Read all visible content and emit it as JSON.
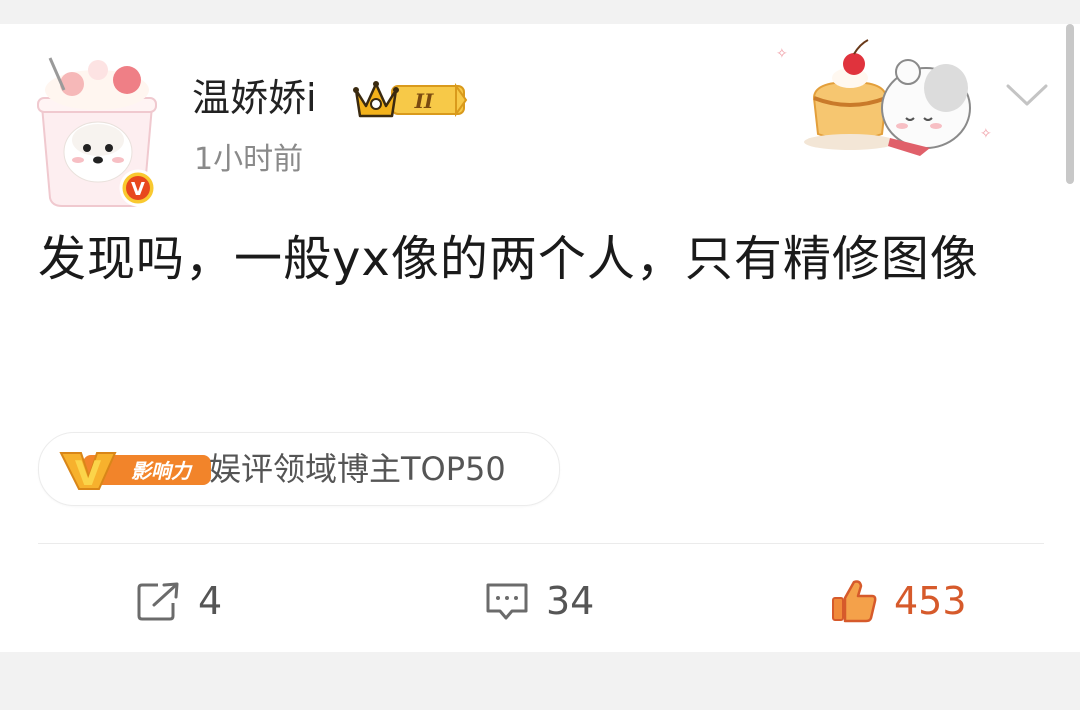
{
  "post": {
    "username": "温娇娇i",
    "vip_level": "II",
    "timestamp": "1小时前",
    "content": "发现吗，一般yx像的两个人，只有精修图像",
    "influence_badge": {
      "label": "影响力",
      "letter": "V",
      "text": "娱评领域博主TOP50"
    }
  },
  "actions": {
    "repost_count": "4",
    "comment_count": "34",
    "like_count": "453"
  },
  "icons": {
    "verified": "verified-v-icon",
    "crown": "crown-icon",
    "more": "chevron-down-icon",
    "repost": "share-icon",
    "comment": "comment-icon",
    "like": "thumbs-up-icon"
  },
  "colors": {
    "like_accent": "#d65a2b",
    "verified": "#e8481d",
    "badge_gold": "#f5a623"
  }
}
